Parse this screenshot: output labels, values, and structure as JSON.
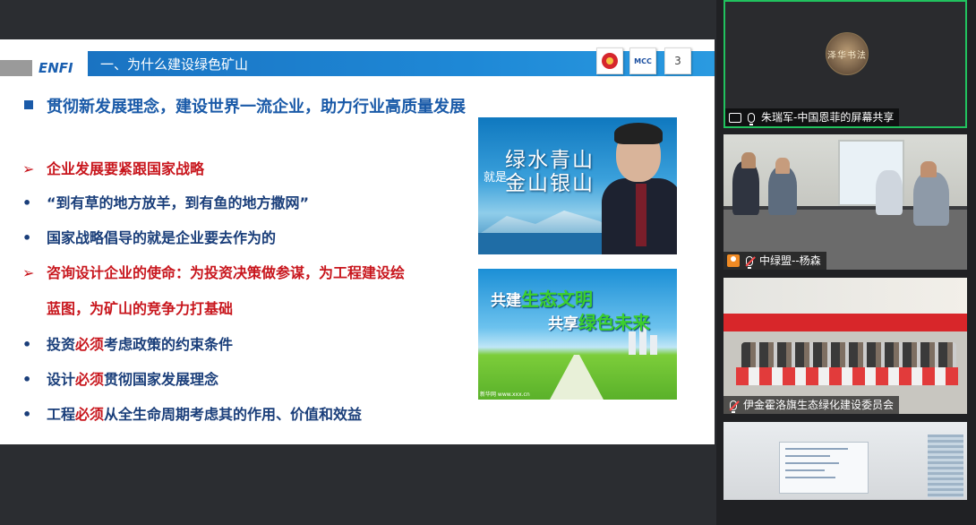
{
  "slide": {
    "logo": "ENFI",
    "header_title": "一、为什么建设绿色矿山",
    "page_number": "3",
    "badge_2_text": "MCC",
    "heading": "贯彻新发展理念，建设世界一流企业，助力行业高质量发展",
    "bullets": [
      {
        "marker": "➢",
        "text": "企业发展要紧跟国家战略",
        "color": "red"
      },
      {
        "marker": "•",
        "text": "“到有草的地方放羊，到有鱼的地方撒网”",
        "color": "blue"
      },
      {
        "marker": "•",
        "text": "国家战略倡导的就是企业要去作为的",
        "color": "blue"
      },
      {
        "marker": "➢",
        "text": "咨询设计企业的使命：为投资决策做参谋，为工程建设绘",
        "color": "red"
      },
      {
        "marker": "",
        "text": "蓝图，为矿山的竞争力打基础",
        "color": "red"
      },
      {
        "marker": "•",
        "pre": "投资",
        "em": "必须",
        "post": "考虑政策的约束条件",
        "color": "blue"
      },
      {
        "marker": "•",
        "pre": "设计",
        "em": "必须",
        "post": "贯彻国家发展理念",
        "color": "blue"
      },
      {
        "marker": "•",
        "pre": "工程",
        "em": "必须",
        "post": "从全生命周期考虑其的作用、价值和效益",
        "color": "blue"
      }
    ],
    "image_top": {
      "line1": "绿水青山",
      "small": "就是",
      "line2": "金山银山"
    },
    "image_bottom": {
      "line1_pre": "共建",
      "line1_em": "生态文明",
      "line2_pre": "共享",
      "line2_em": "绿色未来",
      "footer": "新华网 www.xxx.cn"
    }
  },
  "participants": [
    {
      "name": "朱瑞军-中国恩菲的屏幕共享",
      "avatar_text": "泽华书法",
      "mic": "on",
      "sharing": true
    },
    {
      "name": "中绿盟--杨森",
      "mic": "muted"
    },
    {
      "name": "伊金霍洛旗生态绿化建设委员会",
      "mic": "muted"
    },
    {
      "name": ""
    }
  ],
  "colors": {
    "accent_blue": "#1a5aa8",
    "accent_red": "#c8161d",
    "active_speaker": "#21c25e"
  }
}
